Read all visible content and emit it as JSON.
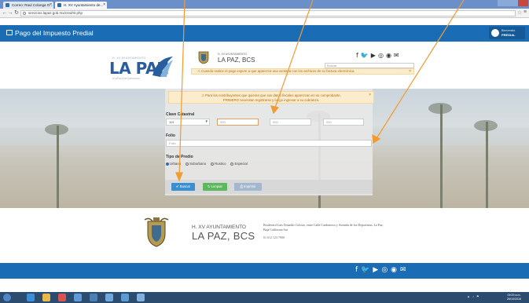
{
  "browser": {
    "tabs": [
      {
        "label": "Correo: Raul Colunga O..."
      },
      {
        "label": "H. XV Ayuntamiento de..."
      }
    ],
    "url": "servicios.lapaz.gob.mx/cred/st.php",
    "icons": {
      "back": "back-arrow-icon",
      "forward": "forward-arrow-icon",
      "reload": "reload-icon",
      "star": "star-icon",
      "menu": "menu-icon"
    }
  },
  "header": {
    "title": "Pago del Impuesto Predial",
    "user_line1": "Bienvenido",
    "user_line2": "PREDIAL"
  },
  "brand": {
    "small": "H. XV AYUNTAMIENTO",
    "big": "LA PAZ",
    "tagline": "#LaPazQueQueremos",
    "ayto_small": "H. XV AYUNTAMIENTO",
    "ayto_big": "LA PAZ, BCS"
  },
  "top": {
    "search_placeholder": "Buscar",
    "warning": "⚠ Cuando realice el pago espere a que aparezca una ventana con los archivos de su factura electrónica.",
    "social": [
      "facebook-icon",
      "twitter-icon",
      "youtube-icon",
      "instagram-icon",
      "rss-icon",
      "mail-icon"
    ]
  },
  "form": {
    "warning_line1": "⚠ Para los contribuyentes que quieran que sus datos fiscales aparezcan en su comprobante,",
    "warning_line2": "PRIMERO necesitan registrarse y luego ingresar a su cobranza.",
    "clave_label": "Clave Catastral",
    "clave_select": "101",
    "clave_f2": "000",
    "clave_f3": "000",
    "clave_f4": "000",
    "folio_label": "Folio",
    "folio_placeholder": "Folio",
    "tipo_label": "Tipo de Predio",
    "tipo_options": [
      "Urbano",
      "Suburbano",
      "Rustico",
      "Especial"
    ],
    "tipo_selected": "Urbano",
    "btn_buscar": "✔ Buscar",
    "btn_limpiar": "↻ Limpiar",
    "btn_imprimir": "⎙ Imprimir"
  },
  "footer": {
    "ayto_small": "H. XV AYUNTAMIENTO",
    "ayto_big": "LA PAZ, BCS",
    "address": "Boulevard Luis Donaldo Colosio, entre Calle Cardoneros y Avenida de los Deportistas, La Paz, Baja California Sur",
    "phone": "01 612 123 7900"
  },
  "taskbar": {
    "clock_time": "09:29 a.m.",
    "clock_date": "26/10/2016"
  },
  "colors": {
    "primary": "#1a6db5",
    "warning_bg": "#fbeccd",
    "warning_text": "#b06b10",
    "btn_primary": "#3a8fd3",
    "btn_success": "#5cb85c",
    "annotation": "#f39a32"
  }
}
